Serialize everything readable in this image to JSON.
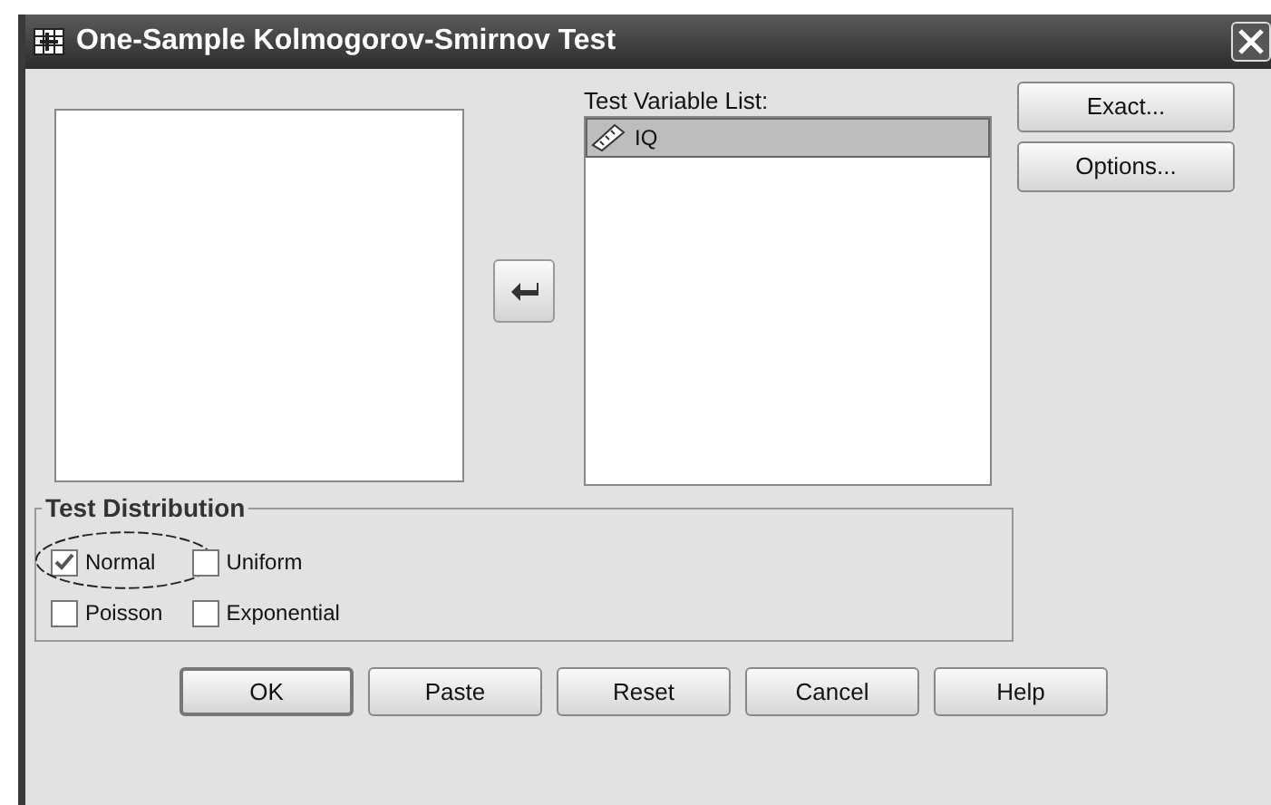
{
  "window": {
    "title": "One-Sample Kolmogorov-Smirnov Test"
  },
  "test_variable_list": {
    "label": "Test Variable List:",
    "items": [
      {
        "name": "IQ",
        "selected": true
      }
    ]
  },
  "side_buttons": [
    "Exact...",
    "Options..."
  ],
  "test_distribution": {
    "title": "Test Distribution",
    "options": [
      {
        "label": "Normal",
        "checked": true,
        "circled": true
      },
      {
        "label": "Uniform",
        "checked": false,
        "circled": false
      },
      {
        "label": "Poisson",
        "checked": false,
        "circled": false
      },
      {
        "label": "Exponential",
        "checked": false,
        "circled": false
      }
    ]
  },
  "buttons": [
    {
      "label": "OK",
      "default": true
    },
    {
      "label": "Paste",
      "default": false
    },
    {
      "label": "Reset",
      "default": false
    },
    {
      "label": "Cancel",
      "default": false
    },
    {
      "label": "Help",
      "default": false
    }
  ]
}
